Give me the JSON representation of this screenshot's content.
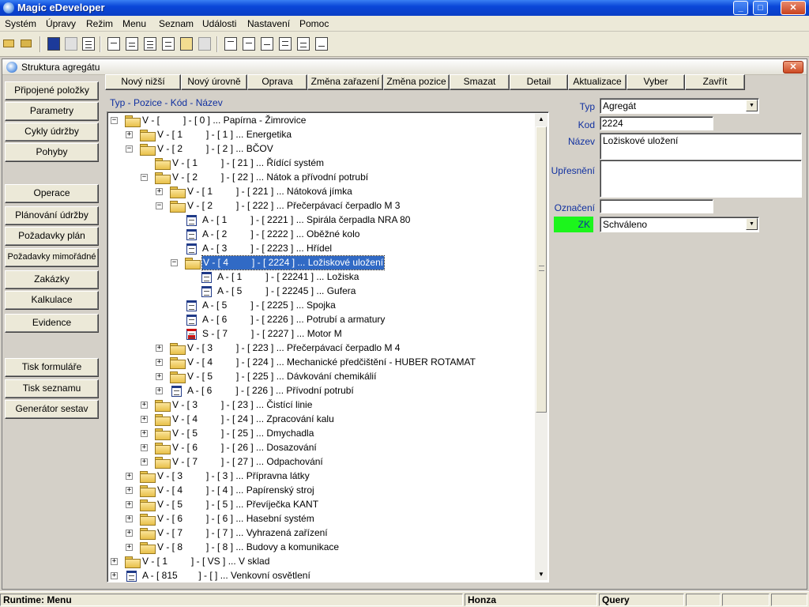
{
  "app": {
    "title": "Magic eDeveloper",
    "window_buttons": {
      "minimize": "_",
      "maximize": "□",
      "close": "✕"
    }
  },
  "menubar": [
    "Systém",
    "Úpravy",
    "Režim",
    "Menu",
    "Seznam",
    "Události",
    "Nastavení",
    "Pomoc"
  ],
  "toolbar_icons": [
    "open-folder-icon",
    "open-file-icon",
    "save-icon",
    "disk-icon",
    "document-icon",
    "zoom-icon",
    "query-zoom-icon",
    "list-icon",
    "table-icon",
    "copy-icon",
    "blank-doc-icon",
    "doc-1-icon",
    "doc-2-icon",
    "doc-3-icon",
    "doc-4-icon",
    "doc-5-icon"
  ],
  "child_window": {
    "title": "Struktura agregátu",
    "close": "✕"
  },
  "side_buttons": {
    "group1": [
      "Připojené položky",
      "Parametry",
      "Cykly údržby",
      "Pohyby"
    ],
    "group2": [
      "Operace",
      "Plánování údržby",
      "Požadavky plán",
      "Požadavky mimořádné",
      "Zakázky",
      "Kalkulace",
      "Evidence"
    ],
    "group3": [
      "Tisk formuláře",
      "Tisk seznamu",
      "Generátor sestav"
    ]
  },
  "top_buttons": [
    "Nový nižší",
    "Nový úrovně",
    "Oprava",
    "Změna zařazení",
    "Změna pozice",
    "Smazat",
    "Detail",
    "Aktualizace",
    "Vyber",
    "Zavřít"
  ],
  "tree_caption": "Typ - Pozice - Kód - Název",
  "tree": [
    {
      "level": 0,
      "exp": "−",
      "icon": "folder",
      "text": "V - [         ] - [ 0 ] ... Papírna - Žimrovice"
    },
    {
      "level": 1,
      "exp": "+",
      "icon": "folder",
      "text": "V - [ 1         ] - [ 1 ] ... Energetika"
    },
    {
      "level": 1,
      "exp": "−",
      "icon": "folder",
      "text": "V - [ 2         ] - [ 2 ] ... BČOV"
    },
    {
      "level": 2,
      "exp": "",
      "icon": "folder",
      "text": "V - [ 1         ] - [ 21 ] ... Řídící systém"
    },
    {
      "level": 2,
      "exp": "−",
      "icon": "folder",
      "text": "V - [ 2         ] - [ 22 ] ... Nátok a přívodní potrubí"
    },
    {
      "level": 3,
      "exp": "+",
      "icon": "folder",
      "text": "V - [ 1         ] - [ 221 ] ... Nátoková jímka"
    },
    {
      "level": 3,
      "exp": "−",
      "icon": "folder",
      "text": "V - [ 2         ] - [ 222 ] ... Přečerpávací čerpadlo M 3"
    },
    {
      "level": 4,
      "exp": "",
      "icon": "doc",
      "text": "A - [ 1         ] - [ 2221 ] ... Spirála čerpadla NRA 80"
    },
    {
      "level": 4,
      "exp": "",
      "icon": "doc",
      "text": "A - [ 2         ] - [ 2222 ] ... Oběžné kolo"
    },
    {
      "level": 4,
      "exp": "",
      "icon": "doc",
      "text": "A - [ 3         ] - [ 2223 ] ... Hřídel"
    },
    {
      "level": 4,
      "exp": "−",
      "icon": "folder",
      "text": "V - [ 4         ] - [ 2224 ] ... Ložiskové uložení",
      "selected": true
    },
    {
      "level": 5,
      "exp": "",
      "icon": "doc",
      "text": "A - [ 1         ] - [ 22241 ] ... Ložiska"
    },
    {
      "level": 5,
      "exp": "",
      "icon": "doc",
      "text": "A - [ 5         ] - [ 22245 ] ... Gufera"
    },
    {
      "level": 4,
      "exp": "",
      "icon": "doc",
      "text": "A - [ 5         ] - [ 2225 ] ... Spojka"
    },
    {
      "level": 4,
      "exp": "",
      "icon": "doc",
      "text": "A - [ 6         ] - [ 2226 ] ... Potrubí a armatury"
    },
    {
      "level": 4,
      "exp": "",
      "icon": "doc-red",
      "text": "S - [ 7         ] - [ 2227 ] ... Motor M"
    },
    {
      "level": 3,
      "exp": "+",
      "icon": "folder",
      "text": "V - [ 3         ] - [ 223 ] ... Přečerpávací čerpadlo M 4"
    },
    {
      "level": 3,
      "exp": "+",
      "icon": "folder",
      "text": "V - [ 4         ] - [ 224 ] ... Mechanické předčištění - HUBER ROTAMAT"
    },
    {
      "level": 3,
      "exp": "+",
      "icon": "folder",
      "text": "V - [ 5         ] - [ 225 ] ... Dávkování chemikálií"
    },
    {
      "level": 3,
      "exp": "+",
      "icon": "doc",
      "text": "A - [ 6         ] - [ 226 ] ... Přívodní potrubí"
    },
    {
      "level": 2,
      "exp": "+",
      "icon": "folder",
      "text": "V - [ 3         ] - [ 23 ] ... Čistící linie"
    },
    {
      "level": 2,
      "exp": "+",
      "icon": "folder",
      "text": "V - [ 4         ] - [ 24 ] ... Zpracování kalu"
    },
    {
      "level": 2,
      "exp": "+",
      "icon": "folder",
      "text": "V - [ 5         ] - [ 25 ] ... Dmychadla"
    },
    {
      "level": 2,
      "exp": "+",
      "icon": "folder",
      "text": "V - [ 6         ] - [ 26 ] ... Dosazování"
    },
    {
      "level": 2,
      "exp": "+",
      "icon": "folder",
      "text": "V - [ 7         ] - [ 27 ] ... Odpachování"
    },
    {
      "level": 1,
      "exp": "+",
      "icon": "folder",
      "text": "V - [ 3         ] - [ 3 ] ... Přípravna látky"
    },
    {
      "level": 1,
      "exp": "+",
      "icon": "folder",
      "text": "V - [ 4         ] - [ 4 ] ... Papírenský stroj"
    },
    {
      "level": 1,
      "exp": "+",
      "icon": "folder",
      "text": "V - [ 5         ] - [ 5 ] ... Převíječka KANT"
    },
    {
      "level": 1,
      "exp": "+",
      "icon": "folder",
      "text": "V - [ 6         ] - [ 6 ] ... Hasební systém"
    },
    {
      "level": 1,
      "exp": "+",
      "icon": "folder",
      "text": "V - [ 7         ] - [ 7 ] ... Vyhrazená zařízení"
    },
    {
      "level": 1,
      "exp": "+",
      "icon": "folder",
      "text": "V - [ 8         ] - [ 8 ] ... Budovy a komunikace"
    },
    {
      "level": 0,
      "exp": "+",
      "icon": "folder",
      "text": "V - [ 1         ] - [ VS ] ... V sklad"
    },
    {
      "level": 0,
      "exp": "+",
      "icon": "doc",
      "text": "A - [ 815        ] - [ ] ... Venkovní osvětlení"
    }
  ],
  "form": {
    "typ_label": "Typ",
    "typ_value": "Agregát",
    "kod_label": "Kod",
    "kod_value": "2224",
    "nazev_label": "Název",
    "nazev_value": "Ložiskové uložení",
    "upresneni_label": "Upřesnění",
    "upresneni_value": "",
    "oznaceni_label": "Označení",
    "oznaceni_value": "",
    "zk_label": "ZK",
    "zk_value": "Schváleno",
    "zk_color": "#1cf51c"
  },
  "statusbar": {
    "left": "Runtime: Menu",
    "user": "Honza",
    "mode": "Query"
  }
}
